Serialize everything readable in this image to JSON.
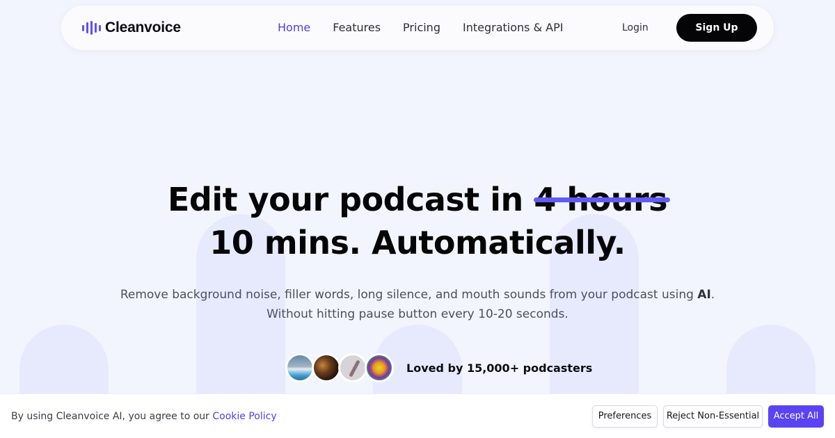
{
  "nav": {
    "logo_text": "Cleanvoice",
    "brand_color": "#5b4ff5",
    "links": [
      "Home",
      "Features",
      "Pricing",
      "Integrations & API"
    ],
    "active_link": "Home",
    "login": "Login",
    "signup": "Sign Up"
  },
  "hero": {
    "title_prefix": "Edit your podcast in",
    "struck_text": "4 hours",
    "title_line2": "10 mins. Automatically.",
    "subtitle_main": "Remove background noise, filler words, long silence, and mouth sounds from your podcast using",
    "subtitle_bold": "AI",
    "subtitle_end": ".",
    "subtitle_line2": "Without hitting pause button every 10-20 seconds.",
    "social_proof": "Loved by 15,000+ podcasters",
    "avatar_count": 4
  },
  "cookie_banner": {
    "text": "By using Cleanvoice AI, you agree to our",
    "link": "Cookie Policy",
    "preferences": "Preferences",
    "reject": "Reject Non-Essential",
    "accept": "Accept All",
    "accent_color": "#5a43f2"
  }
}
